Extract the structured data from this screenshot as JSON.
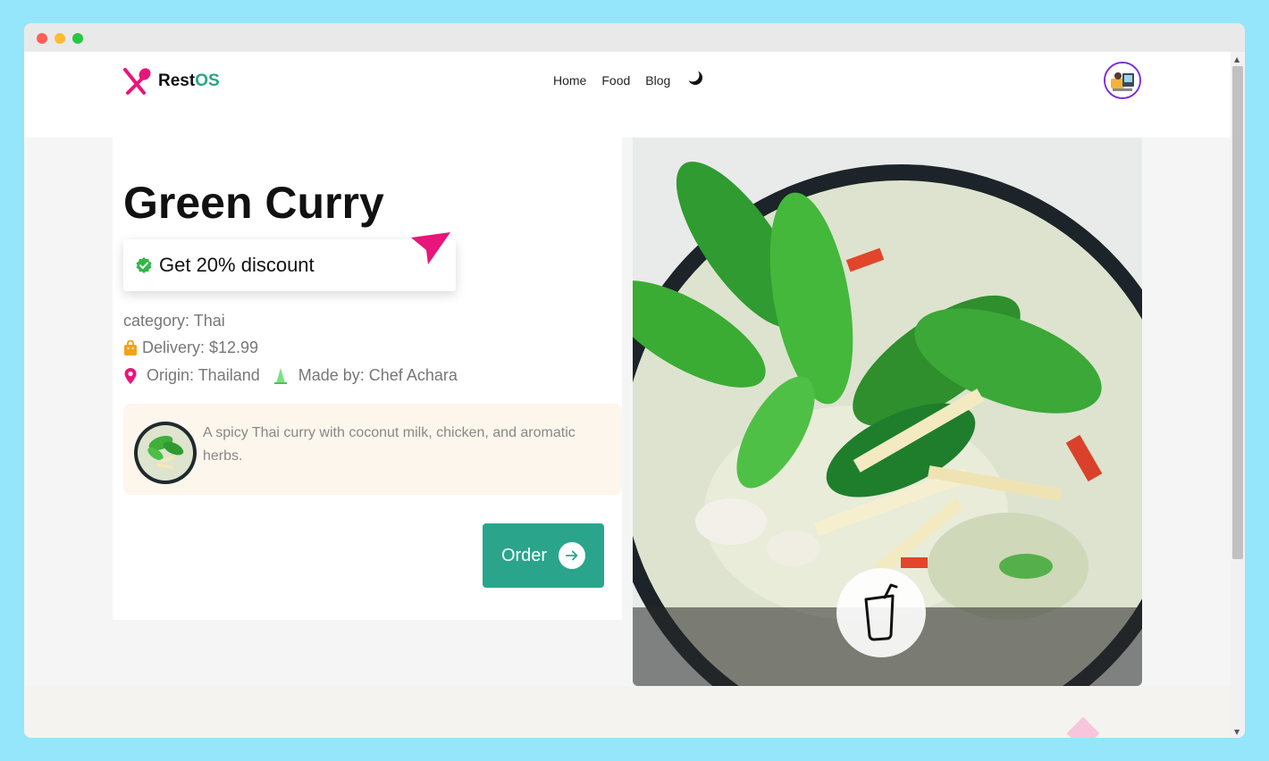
{
  "window": {
    "controls": [
      "close",
      "minimize",
      "maximize"
    ]
  },
  "header": {
    "brand_prefix": "Rest",
    "brand_suffix": "OS",
    "nav": [
      {
        "label": "Home"
      },
      {
        "label": "Food"
      },
      {
        "label": "Blog"
      }
    ],
    "theme_toggle_icon": "moon-icon",
    "avatar_icon": "user-avatar"
  },
  "dish": {
    "title": "Green Curry",
    "discount": "Get 20% discount",
    "category": "category: Thai",
    "delivery": "Delivery: $12.99",
    "origin": "Origin: Thailand",
    "made_by": "Made by: Chef Achara",
    "description": "A spicy Thai curry with coconut milk, chicken, and aromatic herbs.",
    "order_label": "Order"
  },
  "colors": {
    "accent": "#2aa58c",
    "pink": "#e8157a",
    "avatar_ring": "#7b2fd8",
    "description_bg": "#fdf6ec",
    "background": "#f5f5f5"
  },
  "icons": {
    "logo": "spoon-knife-icon",
    "discount": "verified-check-icon",
    "pointer": "cursor-arrow-icon",
    "delivery": "shopping-bag-icon",
    "origin": "map-pin-icon",
    "chef": "chef-icon",
    "order": "arrow-right-icon",
    "drink": "cup-straw-icon"
  }
}
